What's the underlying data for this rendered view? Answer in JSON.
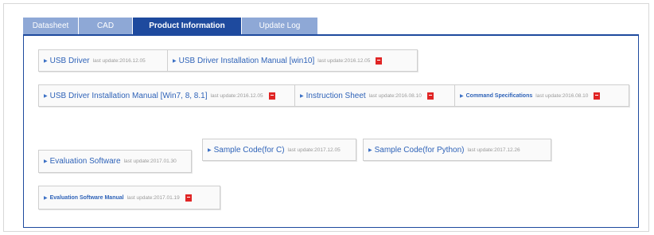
{
  "tabs": [
    {
      "label": "Datasheet",
      "active": false
    },
    {
      "label": "CAD",
      "active": false
    },
    {
      "label": "Product Information",
      "active": true
    },
    {
      "label": "Update Log",
      "active": false
    }
  ],
  "items": [
    {
      "title": "USB Driver",
      "update": "last update:2016.12.05",
      "pdf": false
    },
    {
      "title": "USB Driver Installation Manual [win10]",
      "update": "last update:2016.12.05",
      "pdf": true
    },
    {
      "title": "USB Driver Installation Manual [Win7, 8, 8.1]",
      "update": "last update:2016.12.05",
      "pdf": true
    },
    {
      "title": "Instruction Sheet",
      "update": "last update:2016.08.10",
      "pdf": true
    },
    {
      "title": "Command Specifications",
      "update": "last update:2016.08.10",
      "pdf": true
    },
    {
      "title": "Evaluation Software",
      "update": "last update:2017.01.30",
      "pdf": false
    },
    {
      "title": "Sample Code(for C)",
      "update": "last update:2017.12.05",
      "pdf": false
    },
    {
      "title": "Sample Code(for Python)",
      "update": "last update:2017.12.26",
      "pdf": false
    },
    {
      "title": "Evaluation Software Manual",
      "update": "last update:2017.01.19",
      "pdf": true
    }
  ],
  "icons": {
    "bullet": "triangle-bullet-icon",
    "pdf": "pdf-icon"
  },
  "colors": {
    "active_tab": "#1e4a9e",
    "inactive_tab": "#8ea8d6",
    "link": "#2f63b8",
    "pdf": "#e02525"
  }
}
